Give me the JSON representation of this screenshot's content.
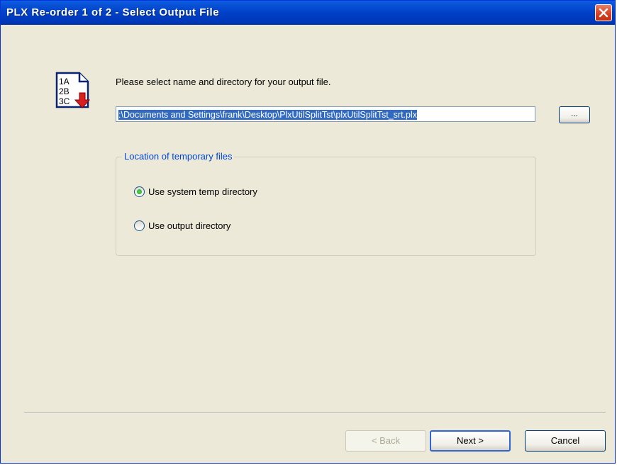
{
  "window": {
    "title": "PLX Re-order 1 of 2 - Select Output File"
  },
  "icon": {
    "lines": [
      "1A",
      "2B",
      "3C"
    ]
  },
  "main": {
    "prompt": "Please select name and directory for your output file.",
    "path_value": ":\\Documents and Settings\\frank\\Desktop\\PlxUtilSplitTst\\plxUtilSplitTst_srt.plx",
    "browse_label": "..."
  },
  "temp_group": {
    "legend": "Location of temporary files",
    "options": [
      {
        "label": "Use system temp directory",
        "selected": true
      },
      {
        "label": "Use output directory",
        "selected": false
      }
    ]
  },
  "footer": {
    "back_label": "< Back",
    "next_label": "Next >",
    "cancel_label": "Cancel"
  }
}
